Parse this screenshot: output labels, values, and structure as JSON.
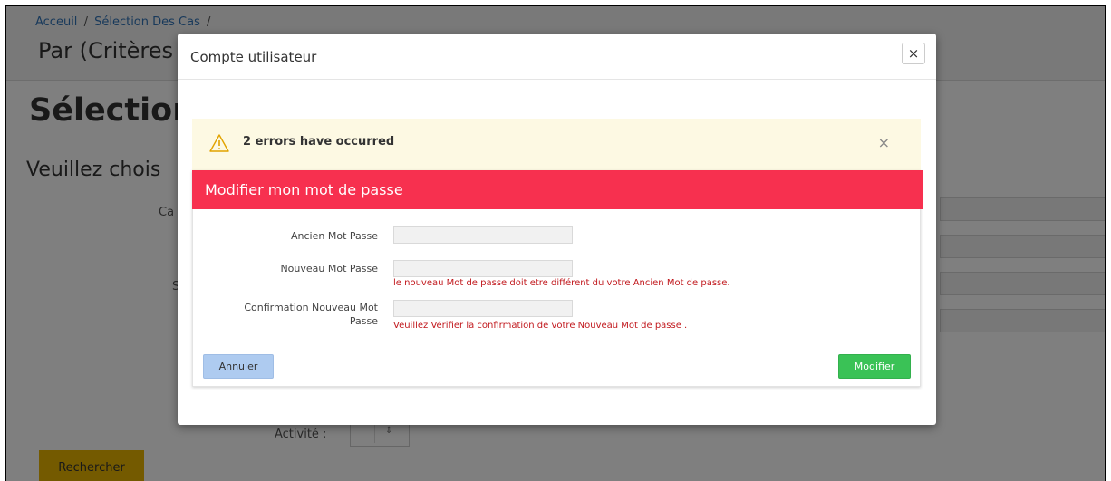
{
  "background": {
    "breadcrumb": [
      "Acceuil",
      "Sélection Des Cas",
      ""
    ],
    "subtitle": "Par (Critères",
    "title": "Sélection",
    "prompt": "Veuillez chois",
    "label_ca": "Ca",
    "label_s": "S",
    "activite_label": "Activité :",
    "search_button": "Rechercher"
  },
  "modal": {
    "title": "Compte utilisateur",
    "close_glyph": "×",
    "alert": {
      "text": "2 errors have occurred",
      "close_glyph": "×",
      "icon": "warning-icon"
    },
    "panel": {
      "title": "Modifier mon mot de passe",
      "fields": [
        {
          "label": "Ancien Mot Passe",
          "value": "",
          "error": ""
        },
        {
          "label": "Nouveau Mot Passe",
          "value": "",
          "error": "le nouveau Mot de passe doit etre différent du votre Ancien Mot de passe."
        },
        {
          "label_line1": "Confirmation Nouveau Mot",
          "label_line2": "Passe",
          "value": "",
          "error": "Veuillez Vérifier la confirmation de votre Nouveau Mot de passe ."
        }
      ],
      "cancel_button": "Annuler",
      "submit_button": "Modifier"
    }
  },
  "colors": {
    "panel_header": "#f7304f",
    "error_text": "#c1181d",
    "alert_bg": "#fdf9e3",
    "cancel_btn": "#aecbf0",
    "submit_btn": "#3ac256",
    "search_btn": "#e8b500",
    "breadcrumb_link": "#3173b6"
  }
}
